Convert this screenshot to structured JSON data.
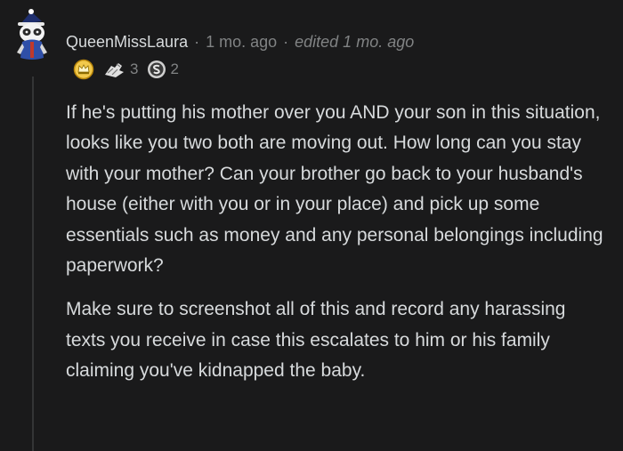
{
  "comment": {
    "author": "QueenMissLaura",
    "separator": "·",
    "time_ago": "1 mo. ago",
    "edited": "edited 1 mo. ago",
    "avatar_icon": "snoo-avatar-icon",
    "awards": [
      {
        "name": "crown-award-icon",
        "count": ""
      },
      {
        "name": "helpful-hands-award-icon",
        "count": "3"
      },
      {
        "name": "silver-award-icon",
        "count": "2"
      }
    ],
    "paragraphs": [
      "If he's putting his mother over you AND your son in this situation, looks like you two both are moving out. How long can you stay with your mother? Can your brother go back to your husband's house (either with you or in your place) and pick up some essentials such as money and any personal belongings including paperwork?",
      "Make sure to screenshot all of this and record any harassing texts you receive in case this escalates to him or his family claiming you've kidnapped the baby."
    ]
  },
  "colors": {
    "background": "#1a1a1b",
    "text": "#d7dadc",
    "meta": "#818384",
    "thread_line": "#343536",
    "gold": "#f2c94c"
  }
}
